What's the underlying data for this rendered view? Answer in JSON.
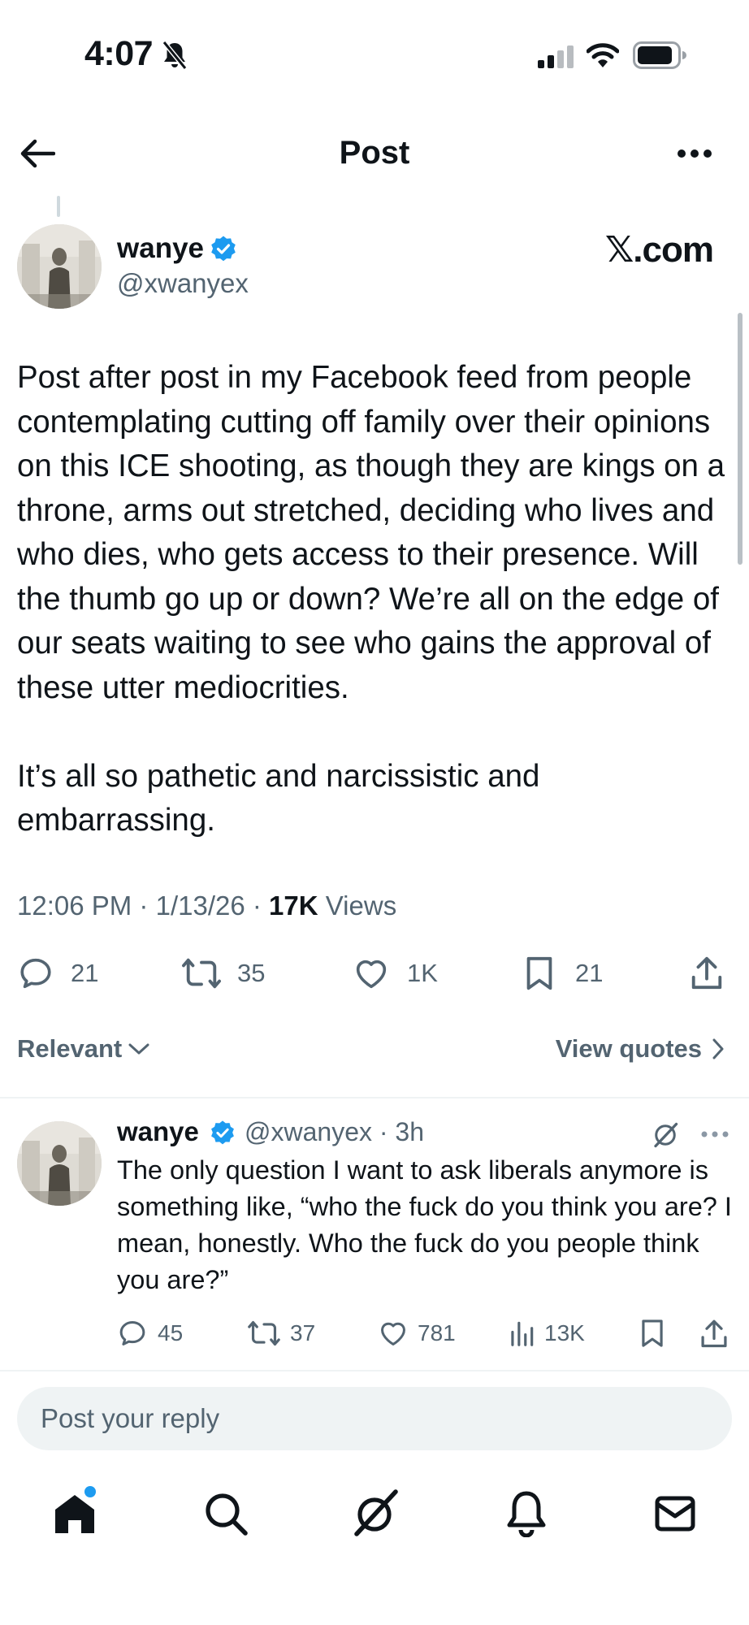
{
  "status_bar": {
    "time": "4:07"
  },
  "header": {
    "title": "Post"
  },
  "post": {
    "author_name": "wanye",
    "author_handle": "@xwanyex",
    "watermark": "𝕏.com",
    "paragraphs": [
      "Post after post in my Facebook feed from people contemplating cutting off family over their opinions on this ICE shooting, as though they are kings on a throne, arms out stretched, deciding who lives and who dies, who gets access to their presence. Will the thumb go up or down? We’re all on the edge of our seats waiting to see who gains the approval of these utter mediocrities.",
      "It’s all so pathetic and narcissistic and embarrassing."
    ],
    "time": "12:06 PM",
    "date": "1/13/26",
    "views_count": "17K",
    "views_label": "Views",
    "actions": {
      "replies": "21",
      "reposts": "35",
      "likes": "1K",
      "bookmarks": "21"
    }
  },
  "sort": {
    "label": "Relevant",
    "view_quotes": "View quotes"
  },
  "reply": {
    "author_name": "wanye",
    "author_handle": "@xwanyex",
    "age": "3h",
    "text": "The only question I want to ask liberals anymore is something like, “who the fuck do you think you are? I mean, honestly. Who the fuck do you people think you are?”",
    "actions": {
      "replies": "45",
      "reposts": "37",
      "likes": "781",
      "views": "13K"
    }
  },
  "composer": {
    "placeholder": "Post your reply"
  },
  "icons": {
    "verified_color": "#1d9bf0",
    "notification_dot_color": "#1d9bf0",
    "nav": [
      "home-icon",
      "search-icon",
      "grok-icon",
      "bell-icon",
      "mail-icon"
    ]
  }
}
